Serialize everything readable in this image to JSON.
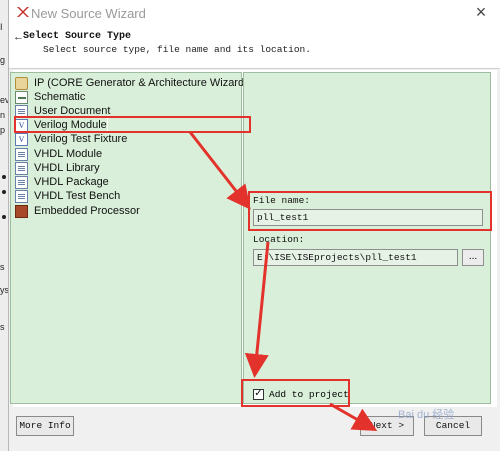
{
  "window": {
    "title": "New Source Wizard",
    "close_glyph": "×"
  },
  "header": {
    "title": "Select Source Type",
    "subtitle": "Select source type, file name and its location."
  },
  "source_types": [
    {
      "label": "IP (CORE Generator & Architecture Wizard)",
      "icon": "ip-core-icon"
    },
    {
      "label": "Schematic",
      "icon": "schematic-icon"
    },
    {
      "label": "User Document",
      "icon": "document-icon"
    },
    {
      "label": "Verilog Module",
      "icon": "verilog-icon",
      "selected": true
    },
    {
      "label": "Verilog Test Fixture",
      "icon": "verilog-icon"
    },
    {
      "label": "VHDL Module",
      "icon": "vhdl-icon"
    },
    {
      "label": "VHDL Library",
      "icon": "vhdl-icon"
    },
    {
      "label": "VHDL Package",
      "icon": "vhdl-icon"
    },
    {
      "label": "VHDL Test Bench",
      "icon": "vhdl-icon"
    },
    {
      "label": "Embedded Processor",
      "icon": "processor-icon"
    }
  ],
  "form": {
    "file_name_label": "File name:",
    "file_name_value": "pll_test1",
    "location_label": "Location:",
    "location_value": "E:\\ISE\\ISEprojects\\pll_test1",
    "browse_label": "...",
    "add_to_project_label": "Add to project",
    "add_to_project_checked": true
  },
  "buttons": {
    "more_info": "More Info",
    "next": "Next >",
    "cancel": "Cancel"
  },
  "watermark": "Bai du 经验",
  "background_fragments": [
    "I",
    "g",
    "ev",
    "n",
    "p",
    "s",
    "ys",
    "s",
    "o"
  ],
  "colors": {
    "panel_green": "#d9efd9",
    "annotation_red": "#e3322b"
  }
}
